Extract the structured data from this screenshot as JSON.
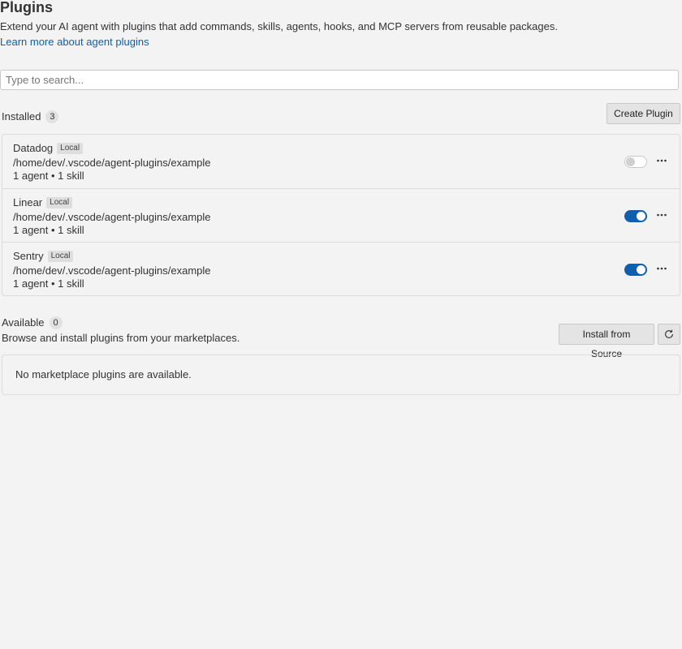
{
  "header": {
    "title": "Plugins",
    "description": "Extend your AI agent with plugins that add commands, skills, agents, hooks, and MCP servers from reusable packages.",
    "learn_link": "Learn more about agent plugins"
  },
  "search": {
    "placeholder": "Type to search...",
    "value": ""
  },
  "installed": {
    "label": "Installed",
    "count": "3",
    "create_button": "Create Plugin",
    "plugins": [
      {
        "name": "Datadog",
        "badge": "Local",
        "path": "/home/dev/.vscode/agent-plugins/example",
        "meta": "1 agent • 1 skill",
        "enabled": false
      },
      {
        "name": "Linear",
        "badge": "Local",
        "path": "/home/dev/.vscode/agent-plugins/example",
        "meta": "1 agent • 1 skill",
        "enabled": true
      },
      {
        "name": "Sentry",
        "badge": "Local",
        "path": "/home/dev/.vscode/agent-plugins/example",
        "meta": "1 agent • 1 skill",
        "enabled": true
      }
    ]
  },
  "available": {
    "label": "Available",
    "count": "0",
    "description": "Browse and install plugins from your marketplaces.",
    "install_button": "Install from Source",
    "refresh_icon": "refresh-icon",
    "empty_message": "No marketplace plugins are available."
  },
  "colors": {
    "accent": "#0f5fae",
    "background": "#f3f3f3",
    "border": "#dcdcdc"
  }
}
